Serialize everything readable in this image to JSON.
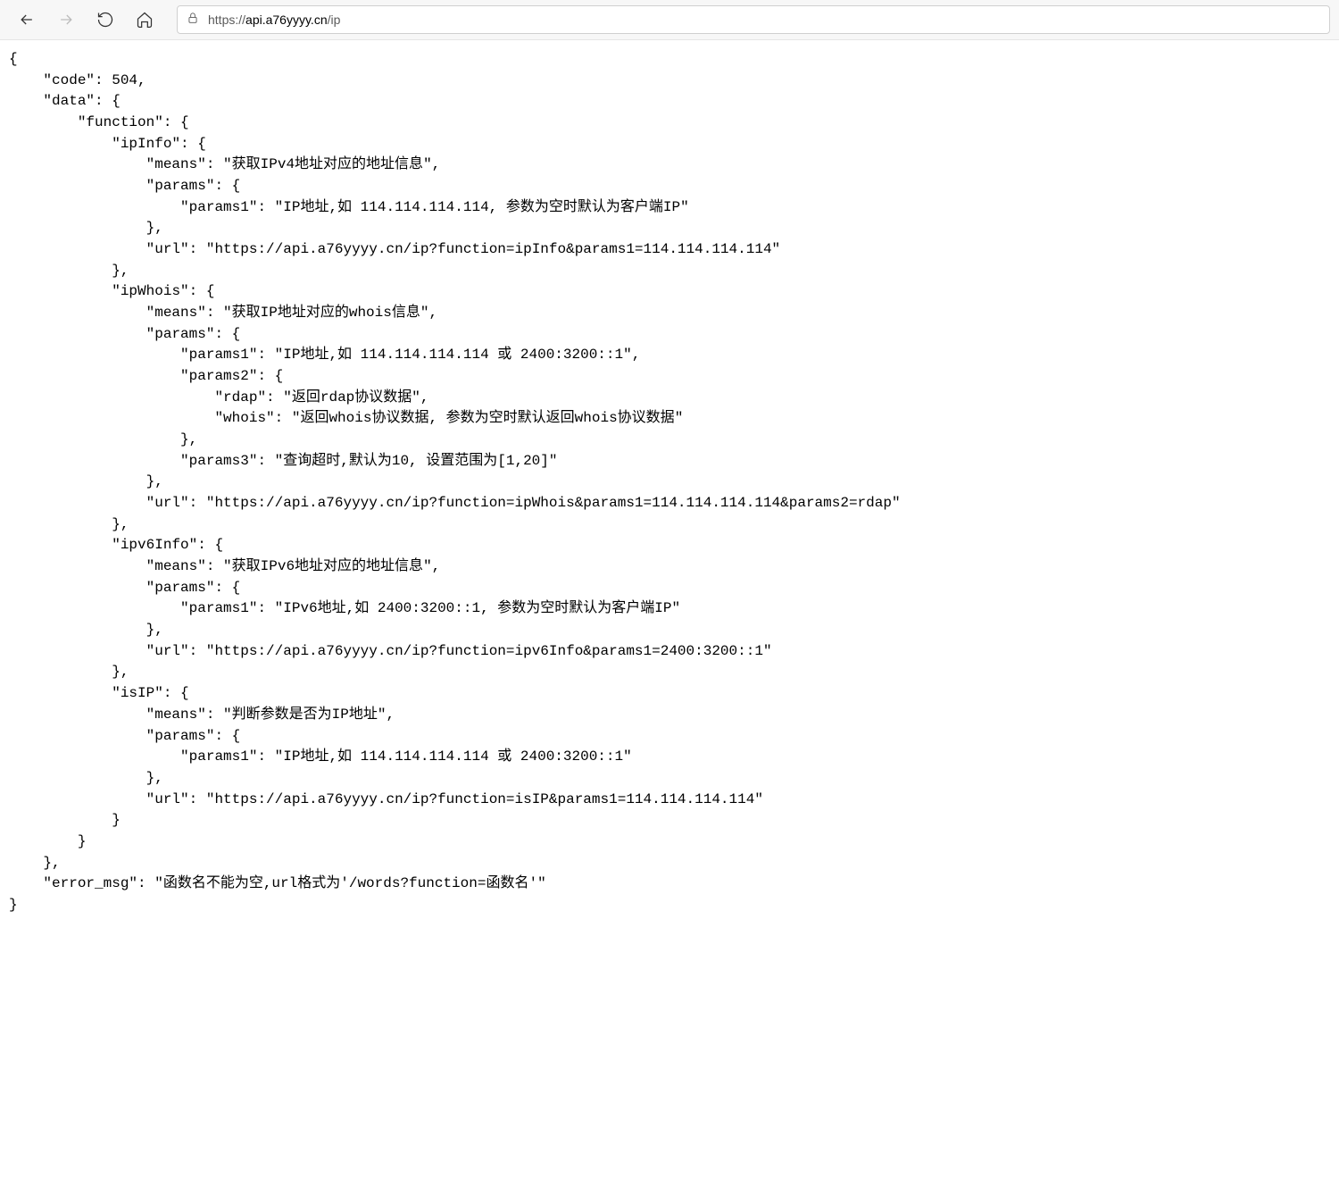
{
  "toolbar": {
    "url_prefix": "https://",
    "url_host": "api.a76yyyy.cn",
    "url_path": "/ip"
  },
  "json": {
    "code": 504,
    "data_label": "data",
    "function_label": "function",
    "ipInfo": {
      "key": "ipInfo",
      "means": "获取IPv4地址对应的地址信息",
      "params_label": "params",
      "params1": "IP地址,如 114.114.114.114, 参数为空时默认为客户端IP",
      "url": "https://api.a76yyyy.cn/ip?function=ipInfo&params1=114.114.114.114"
    },
    "ipWhois": {
      "key": "ipWhois",
      "means": "获取IP地址对应的whois信息",
      "params_label": "params",
      "params1": "IP地址,如 114.114.114.114 或 2400:3200::1",
      "params2_rdap": "返回rdap协议数据",
      "params2_whois": "返回whois协议数据, 参数为空时默认返回whois协议数据",
      "params3": "查询超时,默认为10, 设置范围为[1,20]",
      "url": "https://api.a76yyyy.cn/ip?function=ipWhois&params1=114.114.114.114&params2=rdap"
    },
    "ipv6Info": {
      "key": "ipv6Info",
      "means": "获取IPv6地址对应的地址信息",
      "params_label": "params",
      "params1": "IPv6地址,如 2400:3200::1, 参数为空时默认为客户端IP",
      "url": "https://api.a76yyyy.cn/ip?function=ipv6Info&params1=2400:3200::1"
    },
    "isIP": {
      "key": "isIP",
      "means": "判断参数是否为IP地址",
      "params_label": "params",
      "params1": "IP地址,如 114.114.114.114 或 2400:3200::1",
      "url": "https://api.a76yyyy.cn/ip?function=isIP&params1=114.114.114.114"
    },
    "error_msg": "函数名不能为空,url格式为'/words?function=函数名'"
  }
}
